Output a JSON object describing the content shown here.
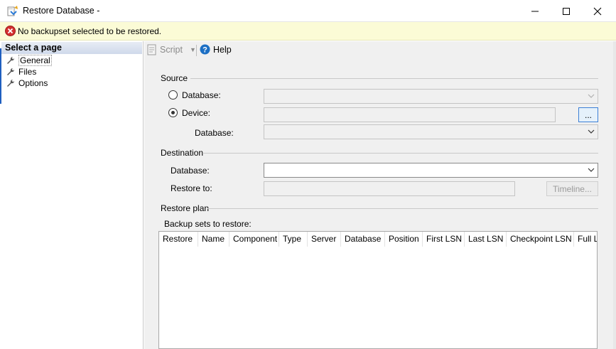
{
  "window": {
    "title": "Restore Database -",
    "controls": {
      "minimize": "minimize",
      "maximize": "maximize",
      "close": "close"
    }
  },
  "message": {
    "text": "No backupset selected to be restored.",
    "icon": "error-icon",
    "color": "#d32f2f"
  },
  "left_pane": {
    "header": "Select a page",
    "items": [
      {
        "label": "General",
        "icon": "wrench-icon",
        "selected": true
      },
      {
        "label": "Files",
        "icon": "wrench-icon"
      },
      {
        "label": "Options",
        "icon": "wrench-icon"
      }
    ]
  },
  "toolbar": {
    "script_label": "Script",
    "help_label": "Help"
  },
  "source": {
    "header": "Source",
    "database_radio_label": "Database:",
    "device_radio_label": "Device:",
    "device_selected": true,
    "device_database_label": "Database:",
    "browse_label": "..."
  },
  "destination": {
    "header": "Destination",
    "database_label": "Database:",
    "restore_to_label": "Restore to:",
    "timeline_label": "Timeline..."
  },
  "restore_plan": {
    "header": "Restore plan",
    "backup_sets_label": "Backup sets to restore:",
    "columns": [
      "Restore",
      "Name",
      "Component",
      "Type",
      "Server",
      "Database",
      "Position",
      "First LSN",
      "Last LSN",
      "Checkpoint LSN",
      "Full LSN"
    ]
  },
  "colors": {
    "accent": "#1f5fbf",
    "message_bg": "#fbfbd6",
    "help_blue": "#1c6fc4"
  }
}
